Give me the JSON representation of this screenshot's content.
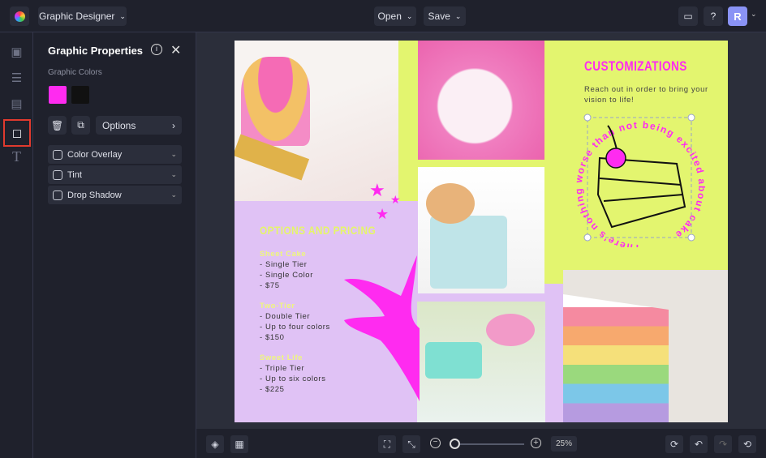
{
  "topbar": {
    "app_menu": "Graphic Designer",
    "open": "Open",
    "save": "Save",
    "avatar": "R"
  },
  "panel": {
    "title": "Graphic Properties",
    "colors_label": "Graphic Colors",
    "swatches": [
      "#ff2bf0",
      "#111111"
    ],
    "options": "Options",
    "accordions": [
      "Color Overlay",
      "Tint",
      "Drop Shadow"
    ]
  },
  "design": {
    "options_title": "OPTIONS AND PRICING",
    "tiers": [
      {
        "name": "Sheet Cake",
        "lines": [
          "- Single Tier",
          "- Single Color",
          "- $75"
        ]
      },
      {
        "name": "Two-Tier",
        "lines": [
          "- Double Tier",
          "- Up to four colors",
          "- $150"
        ]
      },
      {
        "name": "Sweet Life",
        "lines": [
          "- Triple Tier",
          "- Up to six colors",
          "- $225"
        ]
      }
    ],
    "custom_title": "CUSTOMIZATIONS",
    "custom_text": "Reach out in order to bring your vision to life!",
    "circle_text": "There's nothing worse than not being excited about cake"
  },
  "bottombar": {
    "zoom": "25%"
  },
  "colors": {
    "accent": "#ff2bf0",
    "lime": "#e3f56f",
    "purple": "#e0c2f5",
    "highlight": "#e03a2e"
  }
}
